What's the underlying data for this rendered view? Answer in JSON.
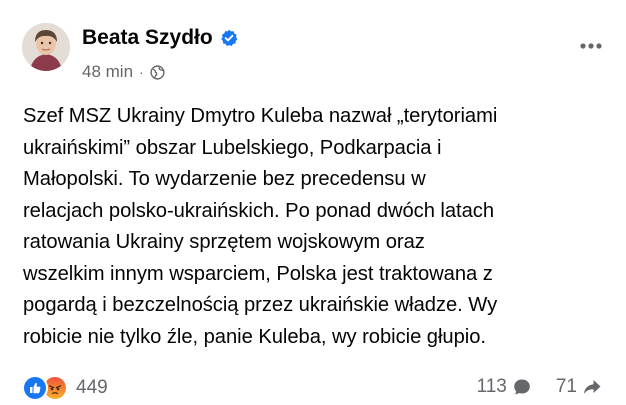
{
  "post": {
    "author": "Beata Szydło",
    "time": "48 min",
    "meta_sep": "·",
    "text": "Szef MSZ Ukrainy Dmytro Kuleba nazwał „terytoriami\nukraińskimi” obszar Lubelskiego, Podkarpacia i\nMałopolski. To wydarzenie bez precedensu w\nrelacjach polsko-ukraińskich. Po ponad dwóch latach\nratowania Ukrainy sprzętem wojskowym oraz\nwszelkim innym wsparciem, Polska jest traktowana z\npogardą i bezczelnością przez ukraińskie władze. Wy\nrobicie nie tylko źle, panie Kuleba, wy robicie głupio."
  },
  "footer": {
    "reaction_count": "449",
    "comment_count": "113",
    "share_count": "71"
  },
  "icons": {
    "verified": "verified-badge-icon",
    "privacy": "globe-icon",
    "more": "more-options-icon",
    "like": "like-reaction-icon",
    "angry": "angry-reaction-icon",
    "comment": "comment-icon",
    "share": "share-icon"
  },
  "colors": {
    "accent": "#1877f2",
    "secondary_text": "#65676b",
    "primary_text": "#050505"
  }
}
